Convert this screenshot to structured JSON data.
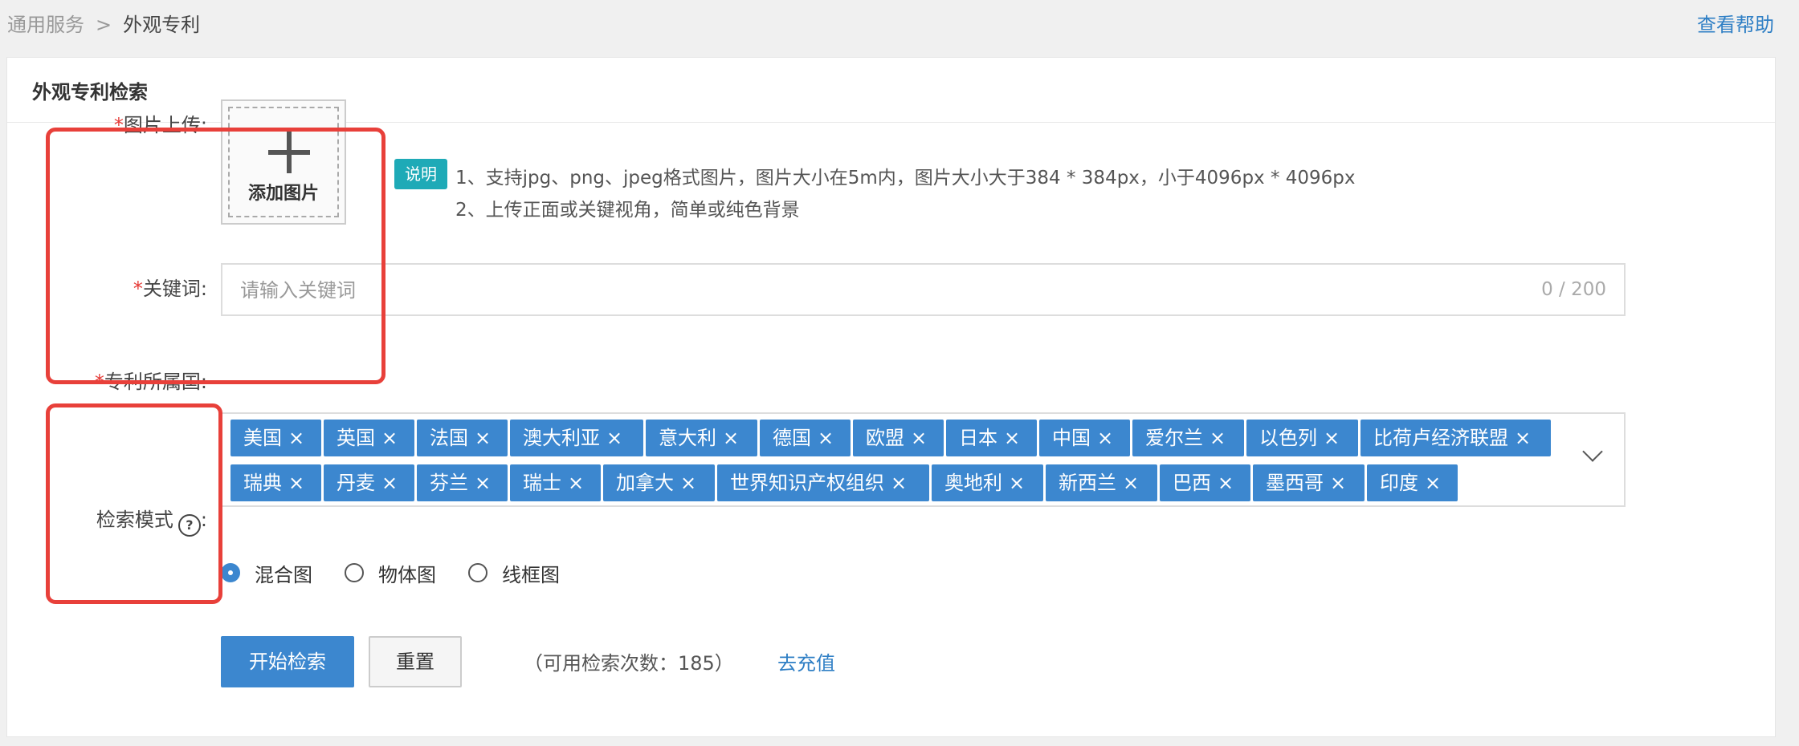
{
  "breadcrumb": {
    "parent": "通用服务",
    "separator": ">",
    "current": "外观专利"
  },
  "help_link": "查看帮助",
  "card": {
    "title": "外观专利检索"
  },
  "form": {
    "upload": {
      "required_mark": "*",
      "label": "图片上传:",
      "button_text": "添加图片",
      "note_badge": "说明",
      "note_line1": "1、支持jpg、png、jpeg格式图片，图片大小在5m内，图片大小大于384 * 384px，小于4096px * 4096px",
      "note_line2": "2、上传正面或关键视角，简单或纯色背景"
    },
    "keyword": {
      "required_mark": "*",
      "label": "关键词:",
      "placeholder": "请输入关键词",
      "value": "",
      "counter": "0 / 200"
    },
    "country": {
      "required_mark": "*",
      "label": "专利所属国:",
      "tags": [
        "美国",
        "英国",
        "法国",
        "澳大利亚",
        "意大利",
        "德国",
        "欧盟",
        "日本",
        "中国",
        "爱尔兰",
        "以色列",
        "比荷卢经济联盟",
        "瑞典",
        "丹麦",
        "芬兰",
        "瑞士",
        "加拿大",
        "世界知识产权组织",
        "奥地利",
        "新西兰",
        "巴西",
        "墨西哥",
        "印度"
      ],
      "remove_glyph": "×"
    },
    "mode": {
      "label": "检索模式",
      "help_glyph": "?",
      "colon": ":",
      "options": [
        "混合图",
        "物体图",
        "线框图"
      ],
      "selected": "混合图"
    }
  },
  "actions": {
    "search_label": "开始检索",
    "reset_label": "重置",
    "usage_text": "（可用检索次数：185）",
    "recharge_label": "去充值"
  },
  "colors": {
    "primary": "#3c87cf",
    "badge": "#1eaab7",
    "required": "#e53935",
    "highlight": "#e8403a",
    "link": "#2f7fc5"
  }
}
